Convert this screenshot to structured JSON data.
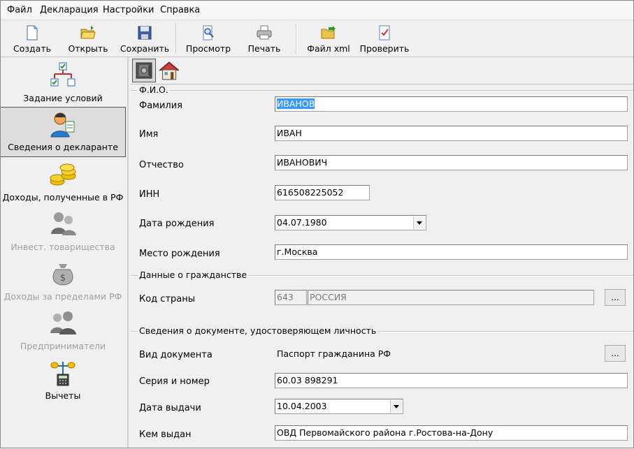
{
  "menu": [
    "Файл",
    "Декларация",
    "Настройки",
    "Справка"
  ],
  "toolbar": {
    "create": "Создать",
    "open": "Открыть",
    "save": "Сохранить",
    "preview": "Просмотр",
    "print": "Печать",
    "xml": "Файл xml",
    "check": "Проверить"
  },
  "sidebar": {
    "items": [
      {
        "label": "Задание условий",
        "icon": "flowchart-icon"
      },
      {
        "label": "Сведения о декларанте",
        "icon": "person-icon",
        "active": true
      },
      {
        "label": "Доходы, полученные в РФ",
        "icon": "coins-icon"
      },
      {
        "label": "Инвест. товарищества",
        "icon": "partners-icon",
        "disabled": true
      },
      {
        "label": "Доходы за пределами РФ",
        "icon": "money-bag-icon",
        "disabled": true
      },
      {
        "label": "Предприниматели",
        "icon": "businessmen-icon",
        "disabled": true
      },
      {
        "label": "Вычеты",
        "icon": "scales-calculator-icon"
      }
    ]
  },
  "tabs": [
    "safe-icon",
    "house-icon"
  ],
  "fio": {
    "title": "Ф.И.О.",
    "surname_label": "Фамилия",
    "surname": "ИВАНОВ",
    "name_label": "Имя",
    "name": "ИВАН",
    "patronymic_label": "Отчество",
    "patronymic": "ИВАНОВИЧ",
    "inn_label": "ИНН",
    "inn": "616508225052",
    "birthdate_label": "Дата рождения",
    "birthdate": "04.07.1980",
    "birthplace_label": "Место рождения",
    "birthplace": "г.Москва"
  },
  "citizenship": {
    "title": "Данные о гражданстве",
    "country_label": "Код страны",
    "country_code": "643",
    "country_name": "РОССИЯ",
    "dots": "..."
  },
  "document": {
    "title": "Сведения о документе, удостоверяющем личность",
    "type_label": "Вид документа",
    "type": "Паспорт гражданина РФ",
    "dots": "...",
    "series_label": "Серия и номер",
    "series": "60.03 898291",
    "issue_date_label": "Дата выдачи",
    "issue_date": "10.04.2003",
    "issued_by_label": "Кем выдан",
    "issued_by": "ОВД Первомайского района г.Ростова-на-Дону"
  }
}
